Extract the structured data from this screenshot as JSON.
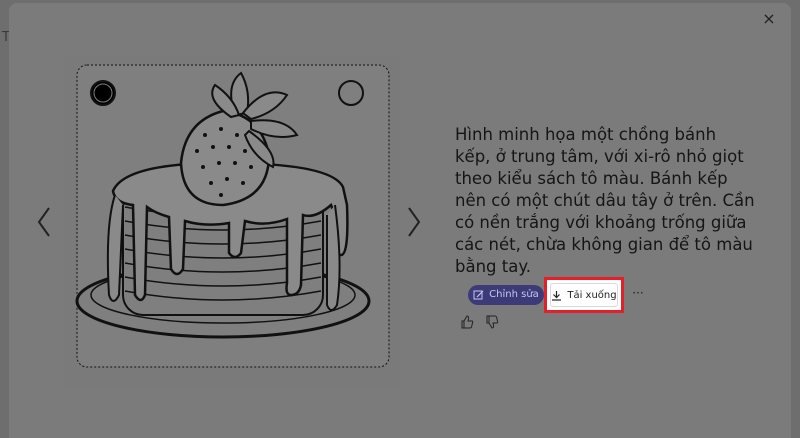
{
  "backdrop": {
    "fragment": "T"
  },
  "modal": {
    "close_label": "×",
    "description": "Hình minh họa một chồng bánh kếp, ở trung tâm, với xi-rô nhỏ giọt theo kiểu sách tô màu. Bánh kếp nên có một chút dâu tây ở trên. Cần có nền trắng với khoảng trống giữa các nét, chừa không gian để tô màu bằng tay.",
    "edit_label": "Chỉnh sửa",
    "download_label": "Tải xuống",
    "more_label": "···",
    "highlight_color": "#e3202a",
    "edit_color": "#3d3a78"
  },
  "icons": {
    "prev": "chevron-left-icon",
    "next": "chevron-right-icon",
    "close": "close-icon",
    "edit": "edit-icon",
    "download": "download-icon",
    "like": "thumbs-up-icon",
    "dislike": "thumbs-down-icon"
  }
}
